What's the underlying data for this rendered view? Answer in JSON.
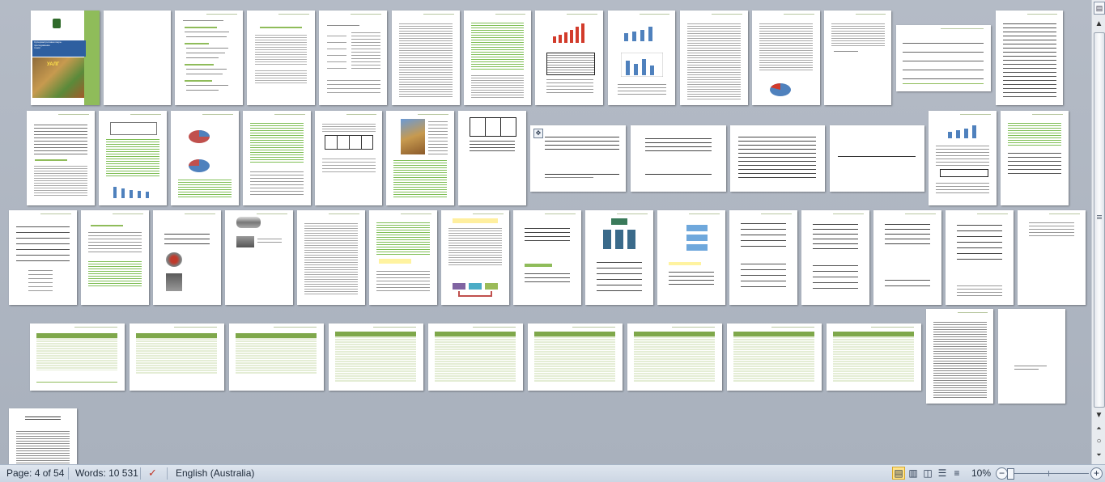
{
  "cover": {
    "title_lines": [
      "Суперкастриговая пюре-",
      "преподавание",
      "тоноп"
    ],
    "brand": "УАЛГ"
  },
  "status": {
    "page": "Page: 4 of 54",
    "words": "Words: 10 531",
    "language": "English (Australia)",
    "zoom": "10%"
  },
  "icons": {
    "proofing": "proofing-icon",
    "print_layout": "print-layout-icon",
    "full_screen_reading": "full-screen-reading-icon",
    "web_layout": "web-layout-icon",
    "outline": "outline-icon",
    "draft": "draft-icon",
    "zoom_out": "zoom-out-icon",
    "zoom_in": "zoom-in-icon",
    "scroll_up": "scroll-up-icon",
    "scroll_down": "scroll-down-icon",
    "prev_page": "prev-page-icon",
    "select_browse_object": "select-browse-object-icon",
    "next_page": "next-page-icon",
    "ruler_toggle": "ruler-toggle-icon"
  },
  "colors": {
    "accent_green": "#8fbc5a",
    "table_green": "#7fa84b",
    "chart_red": "#d23b2b",
    "chart_blue": "#4f81bd"
  }
}
